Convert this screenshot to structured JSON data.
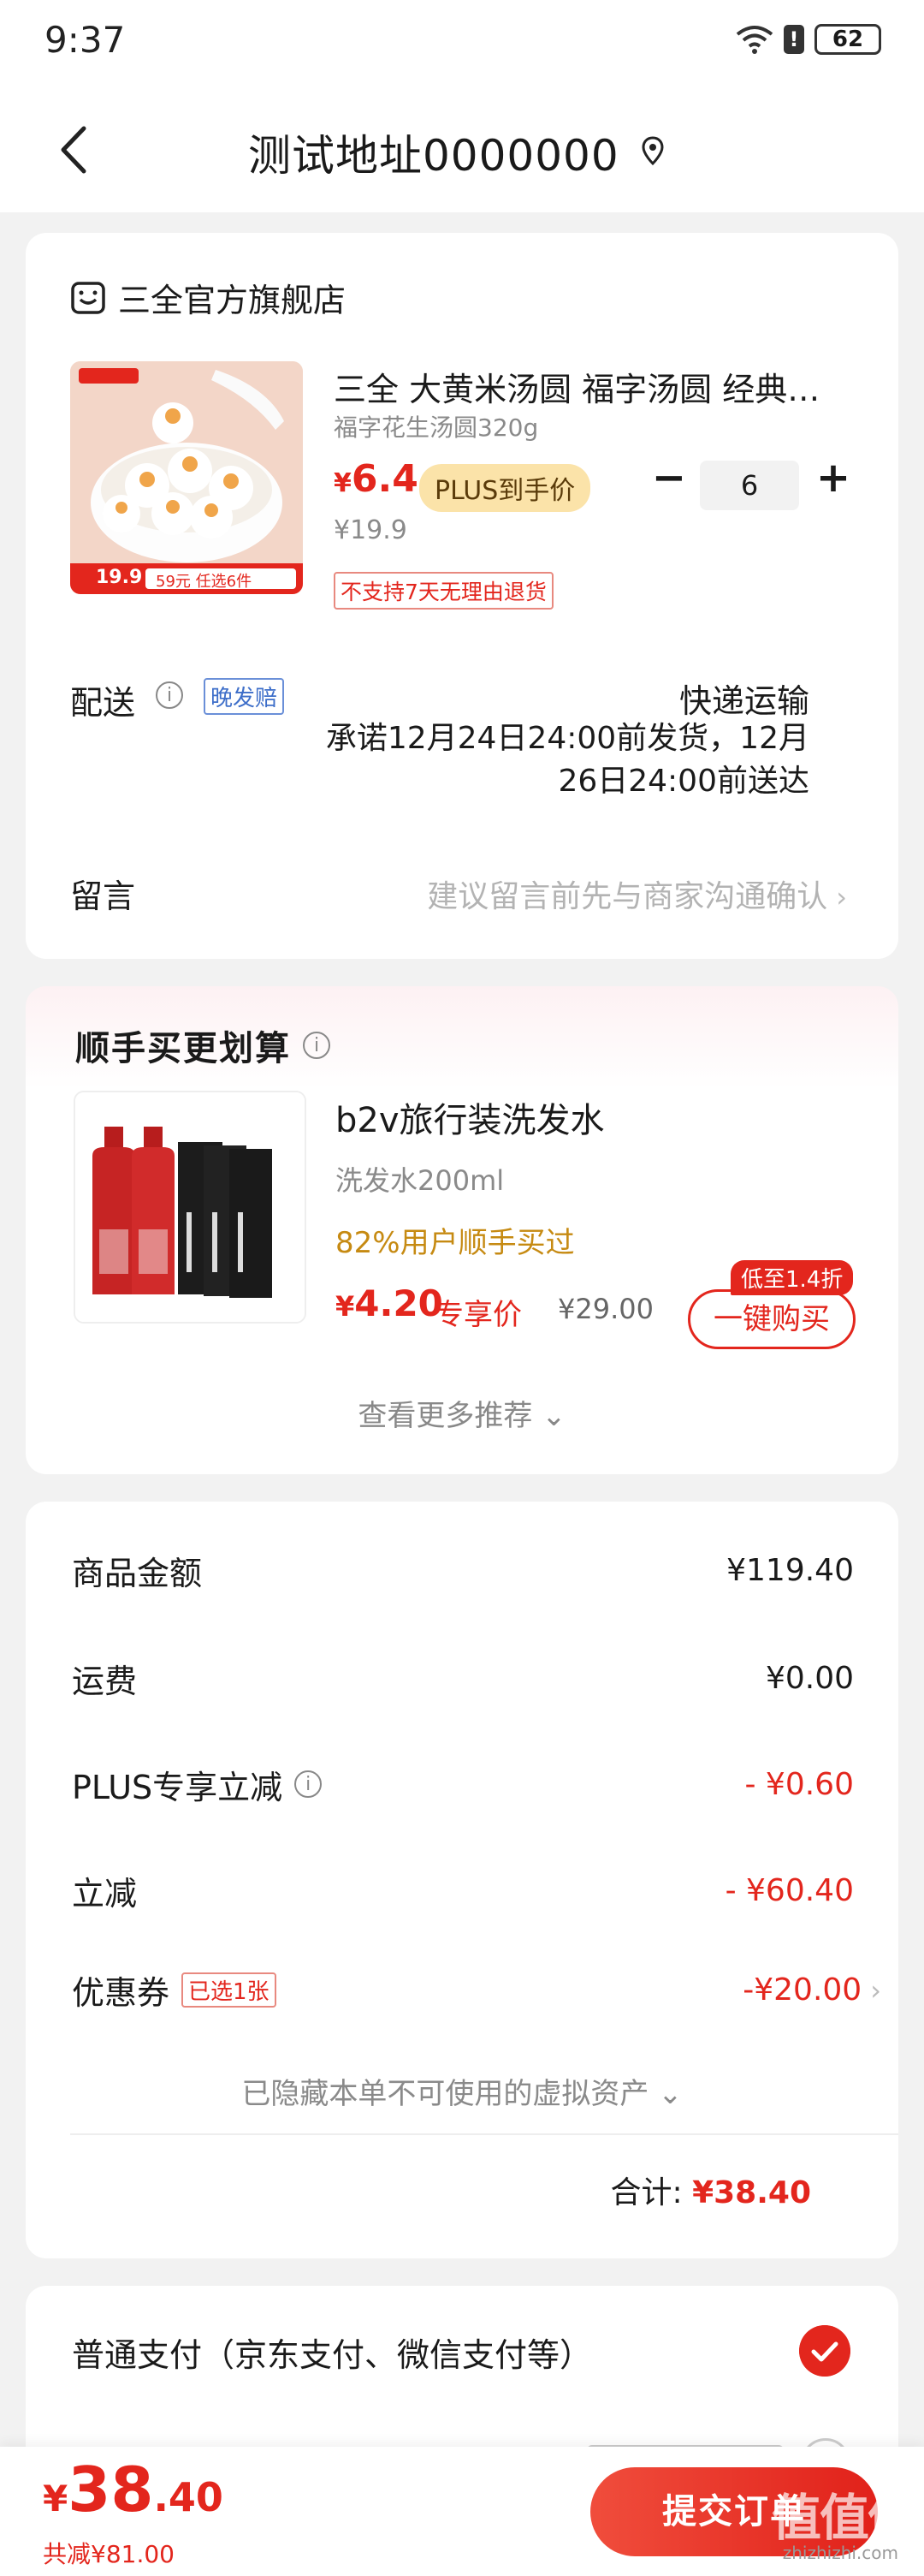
{
  "status_bar": {
    "time": "9:37",
    "battery": "62"
  },
  "nav": {
    "title": "测试地址0000000",
    "back_icon": "back-arrow-icon",
    "location_icon": "location-pin-icon"
  },
  "store": {
    "name": "三全官方旗舰店",
    "product": {
      "title": "三全 大黄米汤圆 福字汤圆 经典…",
      "spec": "福字花生汤圆320g",
      "price_symbol": "¥",
      "price": "6.4",
      "plus_tag": "PLUS到手价",
      "original_price": "¥19.9",
      "quantity": "6",
      "no_return": "不支持7天无理由退货",
      "image_price": "19.9",
      "image_promo": "59元 任选6件"
    },
    "delivery": {
      "label": "配送",
      "late_tag": "晚发赔",
      "method": "快递运输",
      "promise": "承诺12月24日24:00前发货，12月26日24:00前送达"
    },
    "message": {
      "label": "留言",
      "hint": "建议留言前先与商家沟通确认"
    }
  },
  "recommend": {
    "title": "顺手买更划算",
    "item": {
      "title": "b2v旅行装洗发水",
      "spec": "洗发水200ml",
      "bought": "82%用户顺手买过",
      "price_symbol": "¥",
      "price": "4.20",
      "exclusive": "专享价",
      "original_price": "¥29.00",
      "discount_tag": "低至1.4折",
      "buy_button": "一键购买"
    },
    "more": "查看更多推荐"
  },
  "fees": {
    "rows": [
      {
        "label": "商品金额",
        "value": "¥119.40"
      },
      {
        "label": "运费",
        "value": "¥0.00"
      },
      {
        "label": "PLUS专享立减",
        "value": "- ¥0.60"
      },
      {
        "label": "立减",
        "value": "- ¥60.40"
      },
      {
        "label": "优惠券",
        "tag": "已选1张",
        "value": "-¥20.00"
      }
    ],
    "hidden_assets": "已隐藏本单不可使用的虚拟资产",
    "total_label": "合计:",
    "total_value": "¥38.40"
  },
  "payment": {
    "option": "普通支付（京东支付、微信支付等）"
  },
  "bottom": {
    "amount_symbol": "¥",
    "amount_int": "38",
    "amount_dec": ".40",
    "saved": "共减¥81.00",
    "submit": "提交订单",
    "watermark": "值值值",
    "watermark_sub": "zhizhizhi.com"
  }
}
